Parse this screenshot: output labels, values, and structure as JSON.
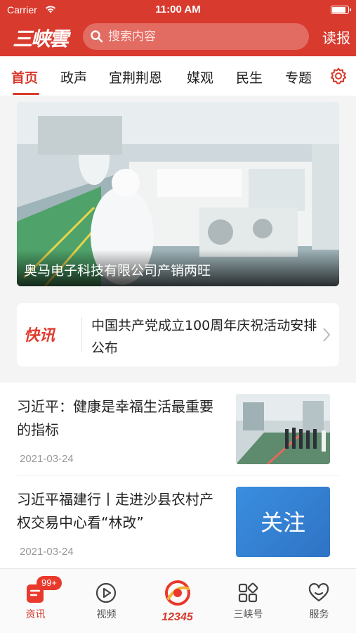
{
  "status_bar": {
    "carrier": "Carrier",
    "time": "11:00 AM"
  },
  "header": {
    "logo_text": "三峡雲",
    "search_placeholder": "搜索内容",
    "read_label": "读报"
  },
  "tabs": [
    {
      "label": "首页",
      "active": true
    },
    {
      "label": "政声"
    },
    {
      "label": "宜荆荆恩"
    },
    {
      "label": "媒观"
    },
    {
      "label": "民生"
    },
    {
      "label": "专题"
    }
  ],
  "hero": {
    "caption": "奥马电子科技有限公司产销两旺"
  },
  "flash": {
    "tag": "快讯",
    "text": "中国共产党成立100周年庆祝活动安排公布"
  },
  "news": [
    {
      "title": "习近平：健康是幸福生活最重要的指标",
      "date": "2021-03-24"
    },
    {
      "title": "习近平福建行丨走进沙县农村产权交易中心看“林改”",
      "date": "2021-03-24",
      "thumb_text": "关注"
    }
  ],
  "bottom_nav": {
    "items": [
      {
        "label": "资讯",
        "badge": "99+",
        "active": true
      },
      {
        "label": "视频"
      },
      {
        "label": "",
        "hotline": "12345"
      },
      {
        "label": "三峡号"
      },
      {
        "label": "服务"
      }
    ]
  },
  "colors": {
    "brand_red": "#d83a2e",
    "follow_blue": "#3a8ee0"
  }
}
